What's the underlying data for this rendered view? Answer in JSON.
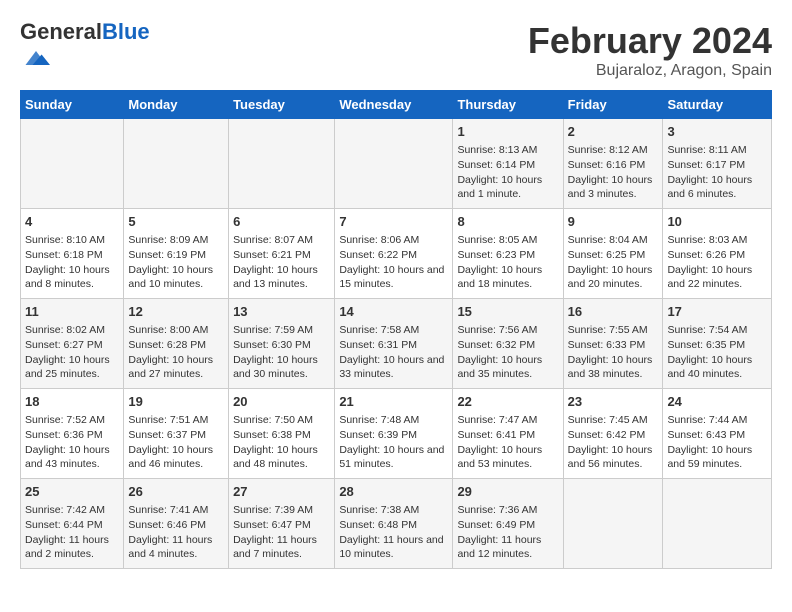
{
  "header": {
    "logo": {
      "general": "General",
      "blue": "Blue"
    },
    "title": "February 2024",
    "subtitle": "Bujaraloz, Aragon, Spain"
  },
  "columns": [
    "Sunday",
    "Monday",
    "Tuesday",
    "Wednesday",
    "Thursday",
    "Friday",
    "Saturday"
  ],
  "weeks": [
    [
      {
        "day": "",
        "content": ""
      },
      {
        "day": "",
        "content": ""
      },
      {
        "day": "",
        "content": ""
      },
      {
        "day": "",
        "content": ""
      },
      {
        "day": "1",
        "content": "Sunrise: 8:13 AM\nSunset: 6:14 PM\nDaylight: 10 hours and 1 minute."
      },
      {
        "day": "2",
        "content": "Sunrise: 8:12 AM\nSunset: 6:16 PM\nDaylight: 10 hours and 3 minutes."
      },
      {
        "day": "3",
        "content": "Sunrise: 8:11 AM\nSunset: 6:17 PM\nDaylight: 10 hours and 6 minutes."
      }
    ],
    [
      {
        "day": "4",
        "content": "Sunrise: 8:10 AM\nSunset: 6:18 PM\nDaylight: 10 hours and 8 minutes."
      },
      {
        "day": "5",
        "content": "Sunrise: 8:09 AM\nSunset: 6:19 PM\nDaylight: 10 hours and 10 minutes."
      },
      {
        "day": "6",
        "content": "Sunrise: 8:07 AM\nSunset: 6:21 PM\nDaylight: 10 hours and 13 minutes."
      },
      {
        "day": "7",
        "content": "Sunrise: 8:06 AM\nSunset: 6:22 PM\nDaylight: 10 hours and 15 minutes."
      },
      {
        "day": "8",
        "content": "Sunrise: 8:05 AM\nSunset: 6:23 PM\nDaylight: 10 hours and 18 minutes."
      },
      {
        "day": "9",
        "content": "Sunrise: 8:04 AM\nSunset: 6:25 PM\nDaylight: 10 hours and 20 minutes."
      },
      {
        "day": "10",
        "content": "Sunrise: 8:03 AM\nSunset: 6:26 PM\nDaylight: 10 hours and 22 minutes."
      }
    ],
    [
      {
        "day": "11",
        "content": "Sunrise: 8:02 AM\nSunset: 6:27 PM\nDaylight: 10 hours and 25 minutes."
      },
      {
        "day": "12",
        "content": "Sunrise: 8:00 AM\nSunset: 6:28 PM\nDaylight: 10 hours and 27 minutes."
      },
      {
        "day": "13",
        "content": "Sunrise: 7:59 AM\nSunset: 6:30 PM\nDaylight: 10 hours and 30 minutes."
      },
      {
        "day": "14",
        "content": "Sunrise: 7:58 AM\nSunset: 6:31 PM\nDaylight: 10 hours and 33 minutes."
      },
      {
        "day": "15",
        "content": "Sunrise: 7:56 AM\nSunset: 6:32 PM\nDaylight: 10 hours and 35 minutes."
      },
      {
        "day": "16",
        "content": "Sunrise: 7:55 AM\nSunset: 6:33 PM\nDaylight: 10 hours and 38 minutes."
      },
      {
        "day": "17",
        "content": "Sunrise: 7:54 AM\nSunset: 6:35 PM\nDaylight: 10 hours and 40 minutes."
      }
    ],
    [
      {
        "day": "18",
        "content": "Sunrise: 7:52 AM\nSunset: 6:36 PM\nDaylight: 10 hours and 43 minutes."
      },
      {
        "day": "19",
        "content": "Sunrise: 7:51 AM\nSunset: 6:37 PM\nDaylight: 10 hours and 46 minutes."
      },
      {
        "day": "20",
        "content": "Sunrise: 7:50 AM\nSunset: 6:38 PM\nDaylight: 10 hours and 48 minutes."
      },
      {
        "day": "21",
        "content": "Sunrise: 7:48 AM\nSunset: 6:39 PM\nDaylight: 10 hours and 51 minutes."
      },
      {
        "day": "22",
        "content": "Sunrise: 7:47 AM\nSunset: 6:41 PM\nDaylight: 10 hours and 53 minutes."
      },
      {
        "day": "23",
        "content": "Sunrise: 7:45 AM\nSunset: 6:42 PM\nDaylight: 10 hours and 56 minutes."
      },
      {
        "day": "24",
        "content": "Sunrise: 7:44 AM\nSunset: 6:43 PM\nDaylight: 10 hours and 59 minutes."
      }
    ],
    [
      {
        "day": "25",
        "content": "Sunrise: 7:42 AM\nSunset: 6:44 PM\nDaylight: 11 hours and 2 minutes."
      },
      {
        "day": "26",
        "content": "Sunrise: 7:41 AM\nSunset: 6:46 PM\nDaylight: 11 hours and 4 minutes."
      },
      {
        "day": "27",
        "content": "Sunrise: 7:39 AM\nSunset: 6:47 PM\nDaylight: 11 hours and 7 minutes."
      },
      {
        "day": "28",
        "content": "Sunrise: 7:38 AM\nSunset: 6:48 PM\nDaylight: 11 hours and 10 minutes."
      },
      {
        "day": "29",
        "content": "Sunrise: 7:36 AM\nSunset: 6:49 PM\nDaylight: 11 hours and 12 minutes."
      },
      {
        "day": "",
        "content": ""
      },
      {
        "day": "",
        "content": ""
      }
    ]
  ]
}
